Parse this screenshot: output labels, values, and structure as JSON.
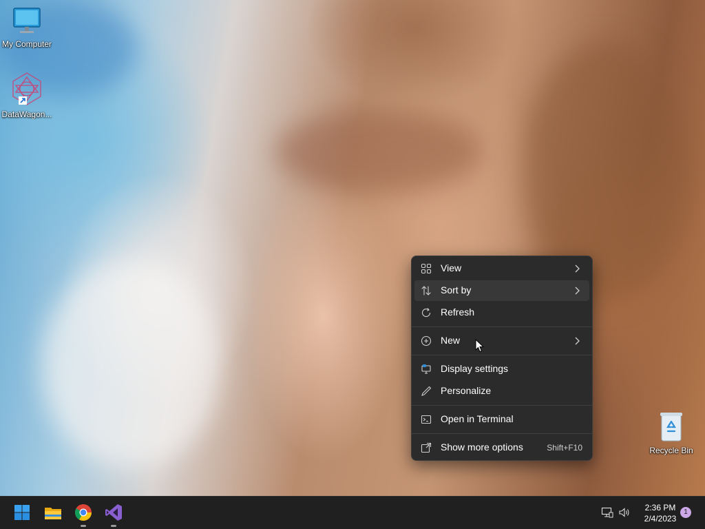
{
  "desktop": {
    "icons": [
      {
        "label": "My Computer",
        "icon": "monitor-icon"
      },
      {
        "label": "DataWagon...",
        "icon": "datawagon-icon"
      },
      {
        "label": "Recycle Bin",
        "icon": "recycle-bin-icon"
      }
    ]
  },
  "context_menu": {
    "items": [
      {
        "label": "View",
        "icon": "view-grid-icon",
        "submenu": true
      },
      {
        "label": "Sort by",
        "icon": "sort-icon",
        "submenu": true
      },
      {
        "label": "Refresh",
        "icon": "refresh-icon"
      },
      {
        "label": "New",
        "icon": "new-plus-icon",
        "submenu": true
      },
      {
        "label": "Display settings",
        "icon": "display-settings-icon"
      },
      {
        "label": "Personalize",
        "icon": "personalize-pen-icon"
      },
      {
        "label": "Open in Terminal",
        "icon": "terminal-icon"
      },
      {
        "label": "Show more options",
        "icon": "more-options-icon",
        "shortcut": "Shift+F10"
      }
    ]
  },
  "taskbar": {
    "apps": [
      {
        "name": "Start",
        "icon": "windows-start-icon"
      },
      {
        "name": "File Explorer",
        "icon": "folder-icon"
      },
      {
        "name": "Google Chrome",
        "icon": "chrome-icon"
      },
      {
        "name": "Visual Studio",
        "icon": "visual-studio-icon"
      }
    ],
    "tray": {
      "time": "2:36 PM",
      "date": "2/4/2023",
      "notification_count": "1"
    }
  },
  "colors": {
    "menu_bg": "#2b2b2b",
    "menu_hover": "#383838",
    "taskbar_bg": "#202020",
    "accent": "#0078d4"
  }
}
